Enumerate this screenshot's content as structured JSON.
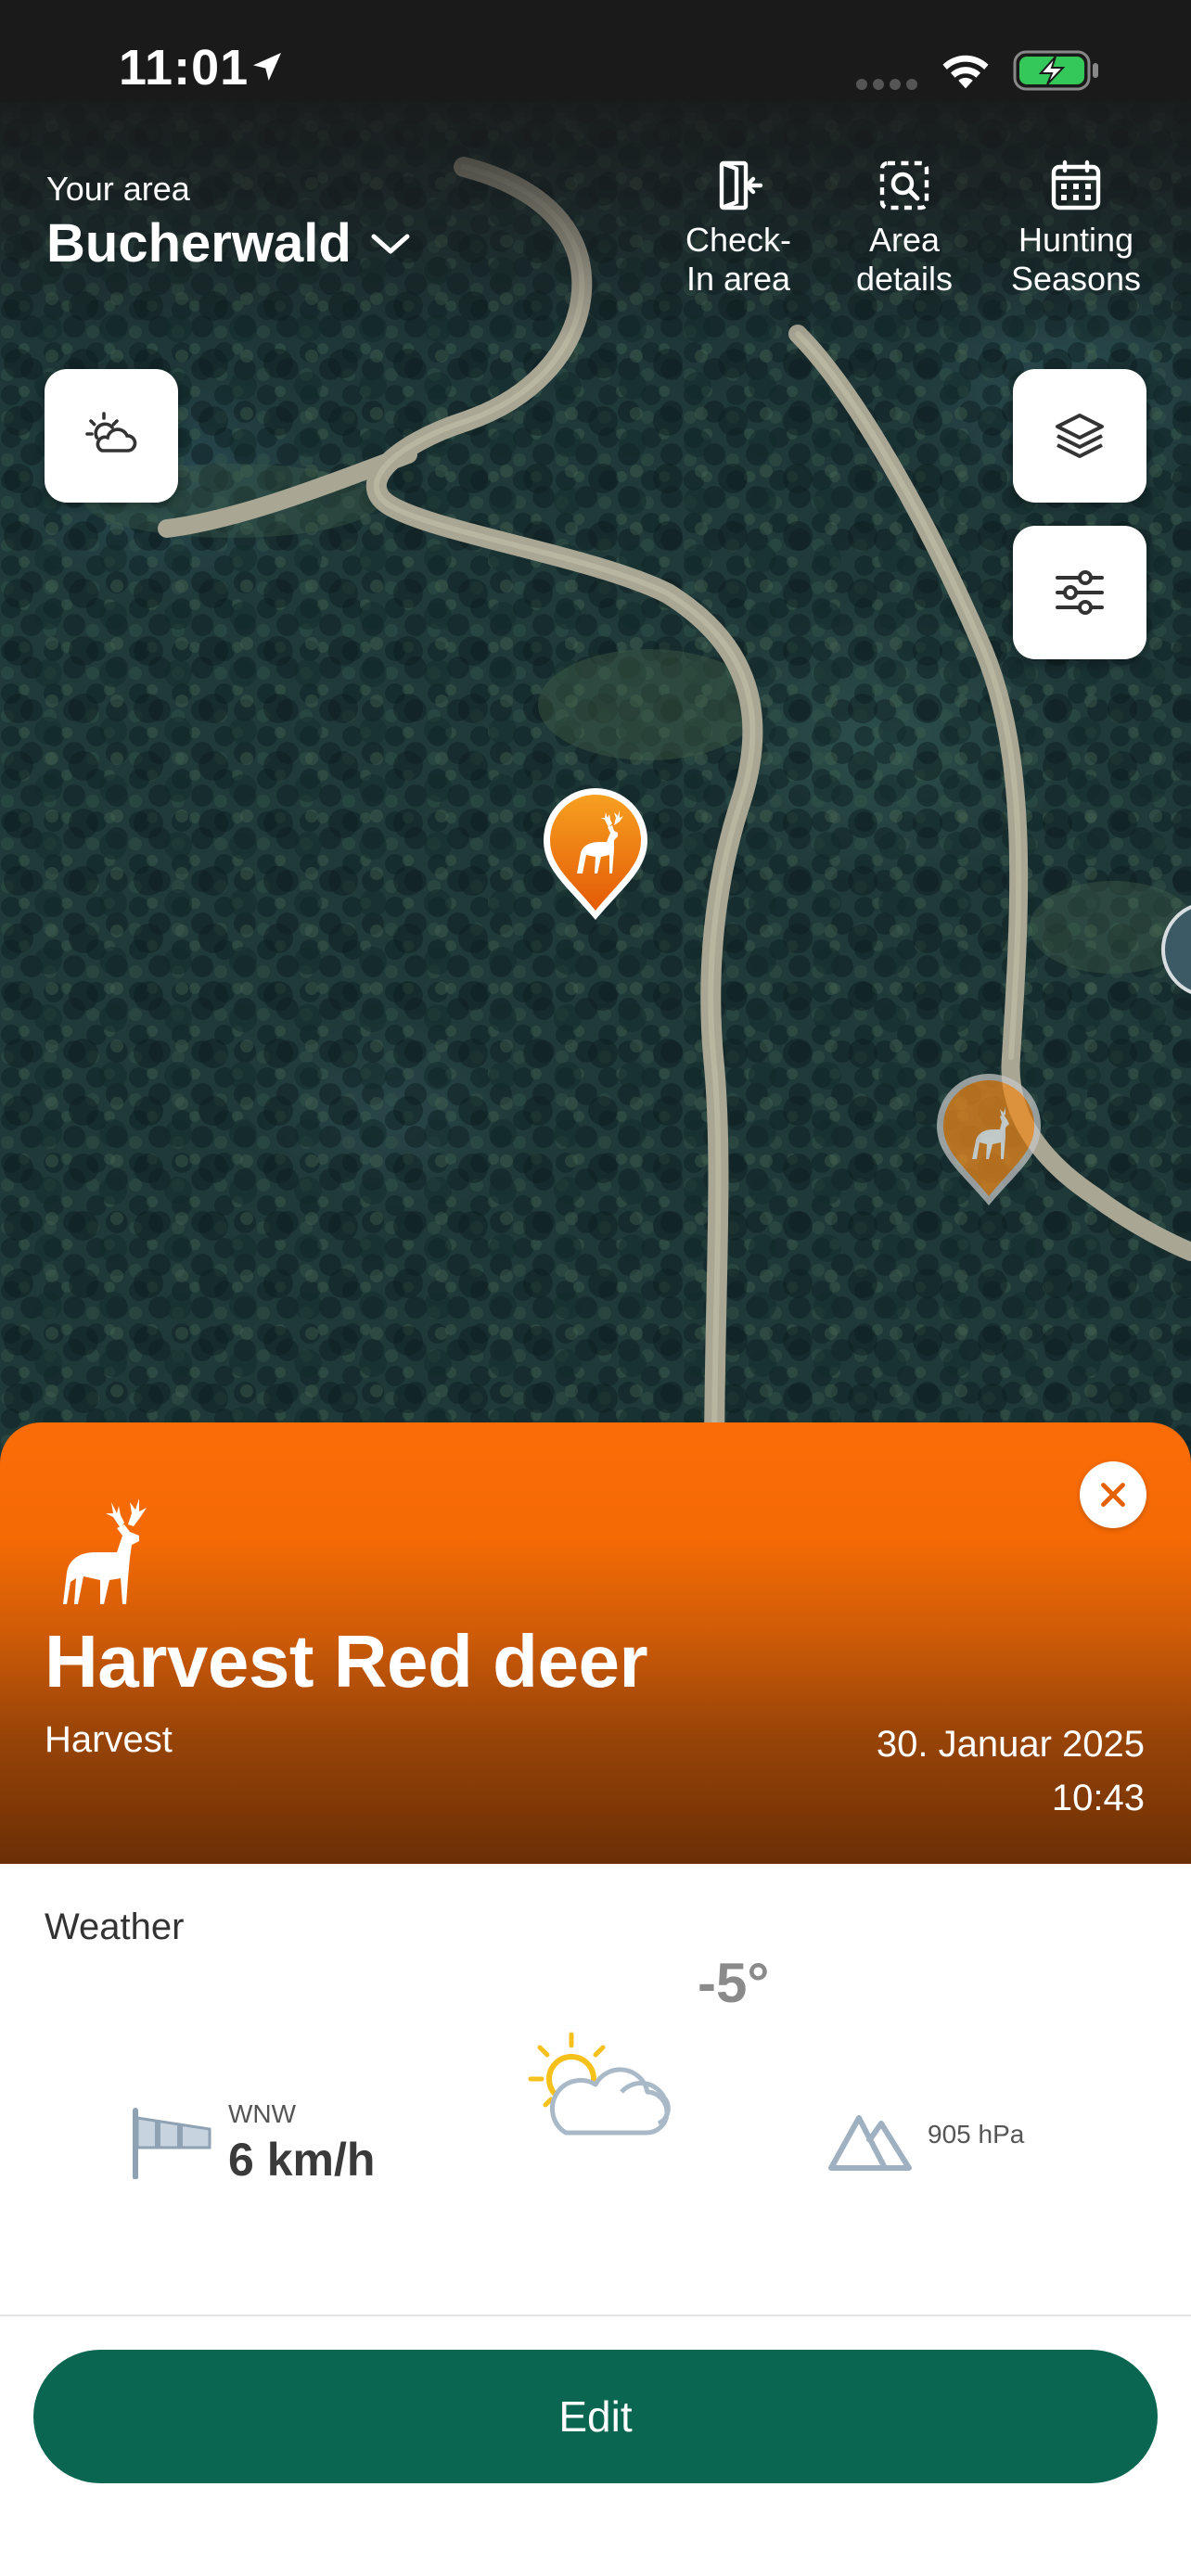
{
  "status_bar": {
    "time": "11:01"
  },
  "header": {
    "area_caption": "Your area",
    "area_name": "Bucherwald",
    "actions": [
      {
        "label": "Check-\nIn area",
        "icon": "door-enter-icon"
      },
      {
        "label": "Area\ndetails",
        "icon": "area-search-icon"
      },
      {
        "label": "Hunting\nSeasons",
        "icon": "calendar-icon"
      }
    ]
  },
  "map_controls": {
    "weather": "cloud-sun-icon",
    "layers": "layers-icon",
    "filters": "sliders-icon"
  },
  "detail": {
    "title": "Harvest Red deer",
    "category": "Harvest",
    "date": "30. Januar 2025",
    "time": "10:43",
    "accent_color": "#f96b06"
  },
  "weather": {
    "section_title": "Weather",
    "temperature": "-5°",
    "wind_direction": "WNW",
    "wind_speed": "6 km/h",
    "pressure": "905 hPa"
  },
  "actions": {
    "edit_label": "Edit",
    "edit_color": "#0a6650"
  }
}
